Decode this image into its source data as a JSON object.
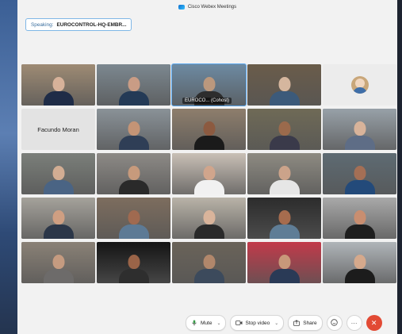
{
  "window": {
    "title": "Cisco Webex Meetings"
  },
  "speaking": {
    "label": "Speaking:",
    "name": "EUROCONTROL-HQ-EMBR..."
  },
  "participants": [
    {
      "type": "video",
      "bg": "#9e8b74",
      "skin": "#d7b29a",
      "shirt": "#1f2c47"
    },
    {
      "type": "video",
      "bg": "#7c8890",
      "skin": "#c99c85",
      "shirt": "#243a56"
    },
    {
      "type": "video",
      "bg": "#6d8aa2",
      "skin": "#bb987d",
      "shirt": "#2d2d2d",
      "active": true,
      "label": "EUROCO... (Cohost)"
    },
    {
      "type": "video",
      "bg": "#6a5c4a",
      "skin": "#d5b69e",
      "shirt": "#3c5a7a"
    },
    {
      "type": "avatar"
    },
    {
      "type": "name",
      "name": "Facundo Moran"
    },
    {
      "type": "video",
      "bg": "#8a9298",
      "skin": "#c49476",
      "shirt": "#2f3e56"
    },
    {
      "type": "video",
      "bg": "#8e7e6c",
      "skin": "#8c5a40",
      "shirt": "#1a1a1a"
    },
    {
      "type": "video",
      "bg": "#6f6a56",
      "skin": "#9b6a4c",
      "shirt": "#3a3a4a"
    },
    {
      "type": "video",
      "bg": "#98a1a8",
      "skin": "#d8b39a",
      "shirt": "#5e6d86"
    },
    {
      "type": "video",
      "bg": "#7b7f7a",
      "skin": "#d2ad93",
      "shirt": "#4a6484"
    },
    {
      "type": "video",
      "bg": "#8d8a86",
      "skin": "#c79a7c",
      "shirt": "#2a2a2a"
    },
    {
      "type": "video",
      "bg": "#c9c0b6",
      "skin": "#d0a58c",
      "shirt": "#f1f1f1"
    },
    {
      "type": "video",
      "bg": "#8e8b82",
      "skin": "#cba38a",
      "shirt": "#e6e6e6"
    },
    {
      "type": "video",
      "bg": "#5e6b73",
      "skin": "#a46f55",
      "shirt": "#234a7a"
    },
    {
      "type": "video",
      "bg": "#a5a29b",
      "skin": "#cf9f82",
      "shirt": "#2b3648"
    },
    {
      "type": "video",
      "bg": "#7d6d5e",
      "skin": "#a06a50",
      "shirt": "#5d7a95"
    },
    {
      "type": "video",
      "bg": "#b9b3a8",
      "skin": "#d9b49b",
      "shirt": "#2a2a2a"
    },
    {
      "type": "video",
      "bg": "#2c2c2c",
      "skin": "#a66c4e",
      "shirt": "#5f7d96"
    },
    {
      "type": "video",
      "bg": "#a9a9a9",
      "skin": "#c98e70",
      "shirt": "#1e1e1e"
    },
    {
      "type": "video",
      "bg": "#8a8176",
      "skin": "#c59b80",
      "shirt": "#6d6b6a"
    },
    {
      "type": "video",
      "bg": "#141414",
      "skin": "#9a6448",
      "shirt": "#2e2e2e"
    },
    {
      "type": "video",
      "bg": "#6a6359",
      "skin": "#b1876b",
      "shirt": "#3c4a5c"
    },
    {
      "type": "video",
      "bg": "#c23a4a",
      "skin": "#c8987a",
      "shirt": "#2a3a56"
    },
    {
      "type": "video",
      "bg": "#b0b5b9",
      "skin": "#d5a98c",
      "shirt": "#1c1c1c"
    }
  ],
  "controls": {
    "mute_label": "Mute",
    "stop_video_label": "Stop video",
    "share_label": "Share",
    "more_glyph": "···",
    "end_glyph": "✕"
  },
  "colors": {
    "accent": "#5aa8f0",
    "end": "#e24a34"
  }
}
